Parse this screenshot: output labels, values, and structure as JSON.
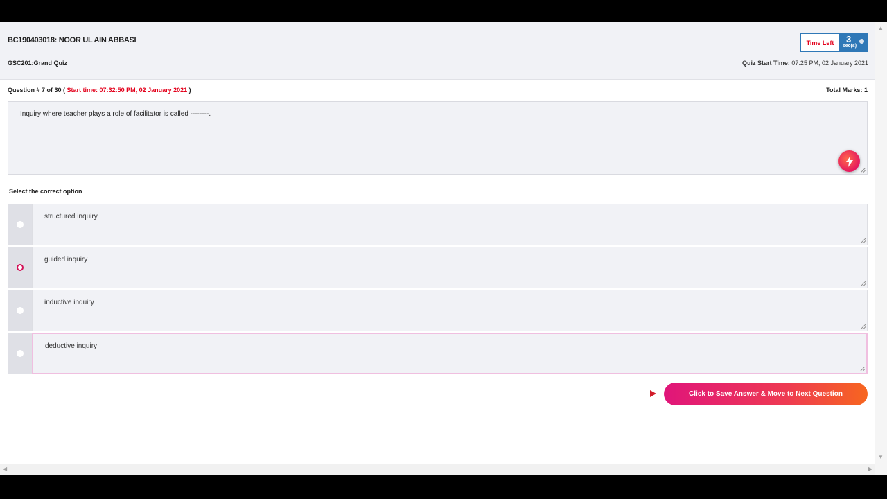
{
  "header": {
    "student": "BC190403018: NOOR UL AIN ABBASI",
    "course": "GSC201:Grand Quiz",
    "quiz_start_label": "Quiz Start Time:",
    "quiz_start_value": "07:25 PM, 02 January 2021",
    "timer": {
      "label": "Time Left",
      "value": "3",
      "unit": "sec(s)"
    }
  },
  "question": {
    "prefix": "Question # 7 of 30 (",
    "start_time": "Start time: 07:32:50 PM, 02 January 2021",
    "suffix": ")",
    "total_marks": "Total Marks: 1",
    "text": "Inquiry where teacher plays a role of facilitator is called --------."
  },
  "select_label": "Select the correct option",
  "options": [
    {
      "text": "structured inquiry",
      "selected": false
    },
    {
      "text": "guided inquiry",
      "selected": true
    },
    {
      "text": "inductive inquiry",
      "selected": false
    },
    {
      "text": "deductive inquiry",
      "selected": false
    }
  ],
  "save_button": "Click to Save Answer & Move to Next Question",
  "colors": {
    "accent_red": "#e3001b",
    "timer_blue": "#2f78b7",
    "button_gradient_start": "#e0157a",
    "button_gradient_end": "#f7661f"
  },
  "icons": {
    "bolt": "lightning-bolt-icon",
    "play": "play-arrow-icon"
  }
}
